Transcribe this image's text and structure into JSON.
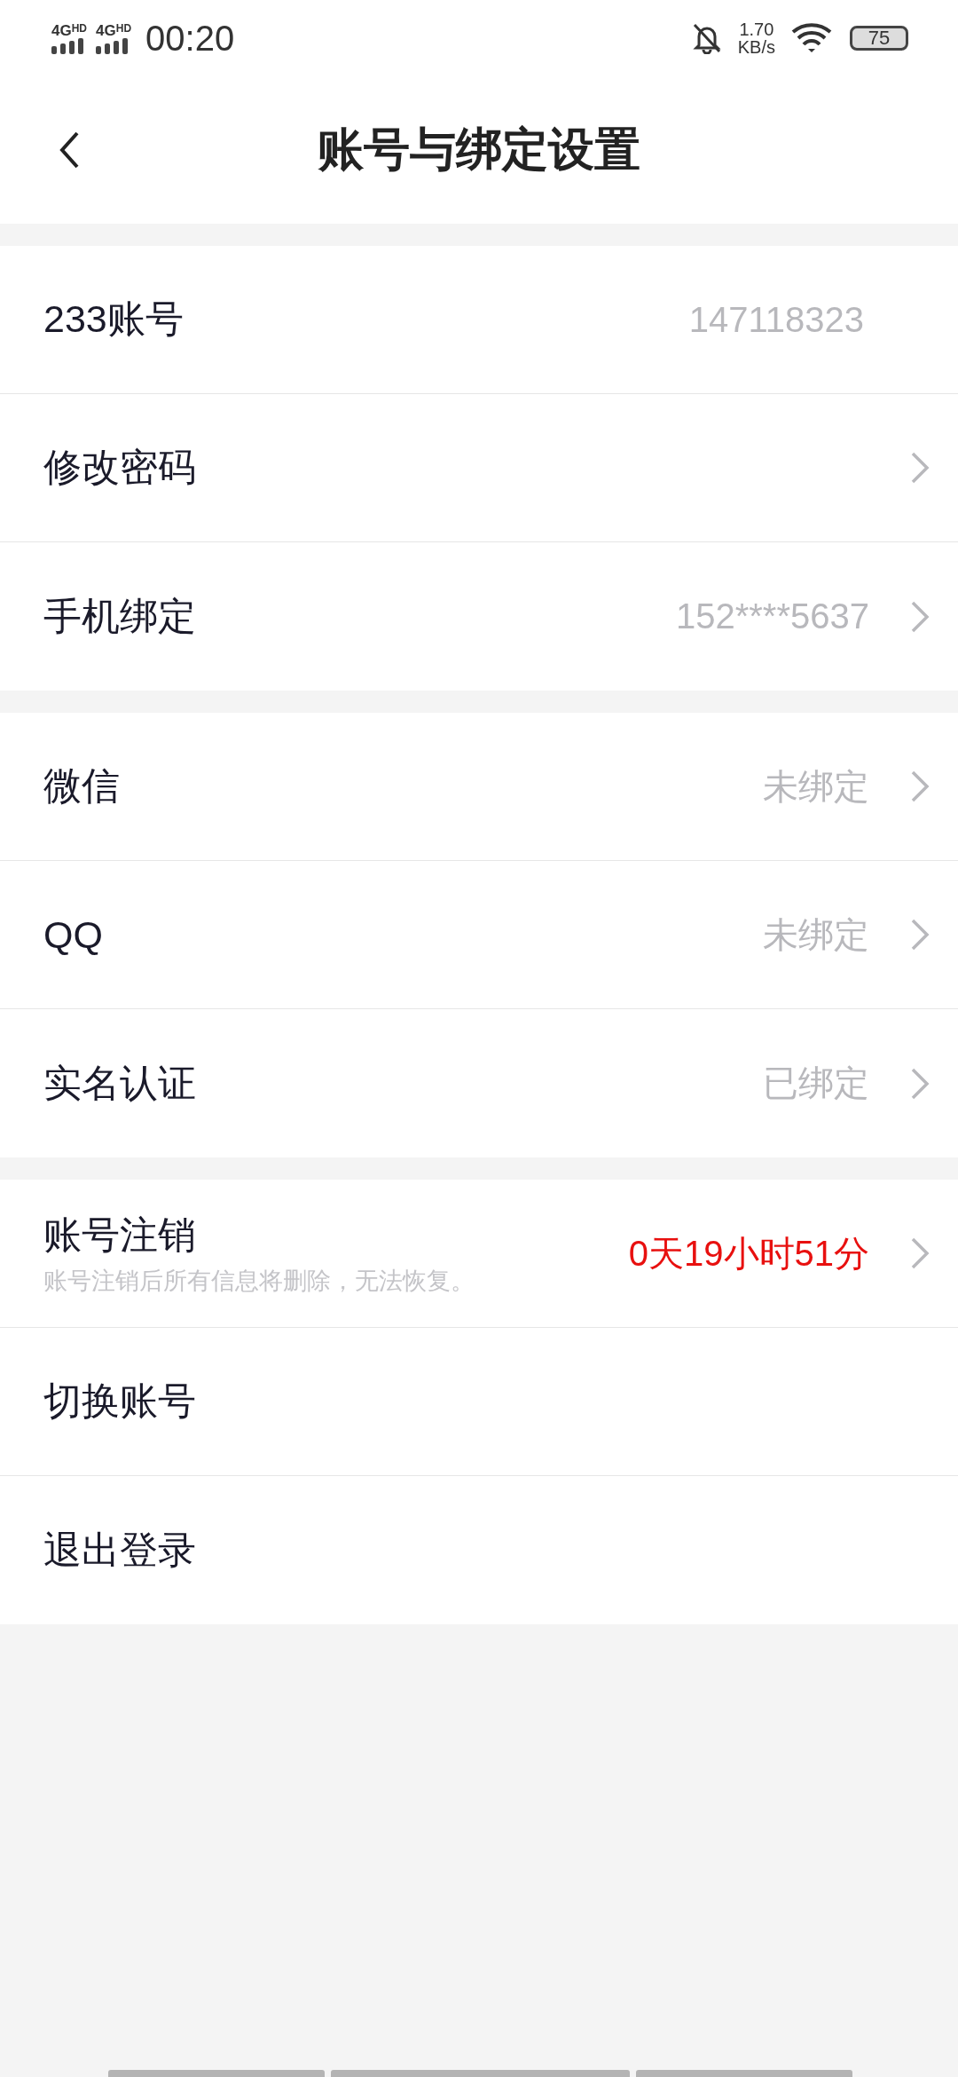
{
  "status_bar": {
    "networks": [
      {
        "label": "4G",
        "badge": "HD"
      },
      {
        "label": "4G",
        "badge": "HD"
      }
    ],
    "time": "00:20",
    "speed": "1.70",
    "speed_unit": "KB/s",
    "battery": "75"
  },
  "header": {
    "title": "账号与绑定设置"
  },
  "groups": [
    {
      "rows": [
        {
          "label": "233账号",
          "value": "147118323",
          "chevron": false
        },
        {
          "label": "修改密码",
          "chevron": true
        },
        {
          "label": "手机绑定",
          "value": "152****5637",
          "chevron": true
        }
      ]
    },
    {
      "rows": [
        {
          "label": "微信",
          "value": "未绑定",
          "chevron": true
        },
        {
          "label": "QQ",
          "value": "未绑定",
          "chevron": true
        },
        {
          "label": "实名认证",
          "value": "已绑定",
          "chevron": true
        }
      ]
    },
    {
      "rows": [
        {
          "label": "账号注销",
          "subtitle": "账号注销后所有信息将删除，无法恢复。",
          "value": "0天19小时51分",
          "chevron": true,
          "highlight": true
        },
        {
          "label": "切换账号",
          "chevron": false
        },
        {
          "label": "退出登录",
          "chevron": false
        }
      ]
    }
  ]
}
